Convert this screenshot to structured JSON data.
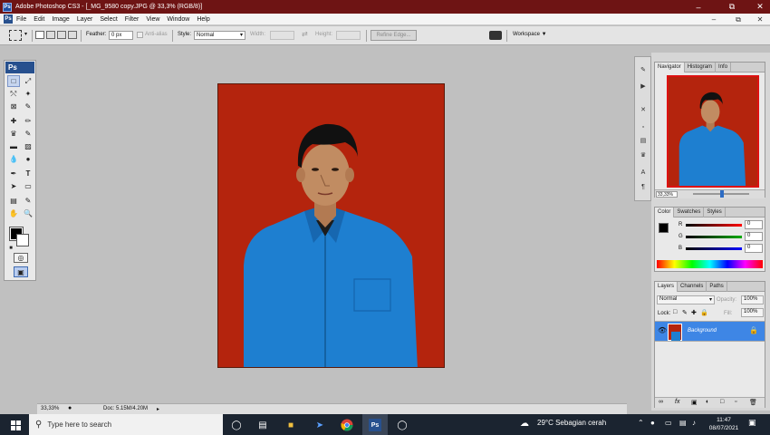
{
  "window": {
    "title": "Adobe Photoshop CS3 - [_MG_9580 copy.JPG @ 33,3% (RGB/8)]",
    "app_badge": "Ps",
    "controls": [
      "–",
      "⧉",
      "✕"
    ]
  },
  "menu": {
    "items": [
      "File",
      "Edit",
      "Image",
      "Layer",
      "Select",
      "Filter",
      "View",
      "Window",
      "Help"
    ]
  },
  "options": {
    "feather_label": "Feather:",
    "feather_value": "0 px",
    "antialias_label": "Anti-alias",
    "style_label": "Style:",
    "style_value": "Normal",
    "width_label": "Width:",
    "height_label": "Height:",
    "refine_edge": "Refine Edge...",
    "workspace": "Workspace ▼"
  },
  "toolbox": {
    "badge": "Ps"
  },
  "document": {
    "background_color": "#b4240d",
    "shirt_color": "#1e7fd0"
  },
  "navigator": {
    "tabs": [
      "Navigator",
      "Histogram",
      "Info"
    ],
    "zoom": "33,33%"
  },
  "color": {
    "tabs": [
      "Color",
      "Swatches",
      "Styles"
    ],
    "channels": [
      {
        "label": "R",
        "value": "0"
      },
      {
        "label": "G",
        "value": "0"
      },
      {
        "label": "B",
        "value": "0"
      }
    ]
  },
  "layers": {
    "tabs": [
      "Layers",
      "Channels",
      "Paths"
    ],
    "blend_mode": "Normal",
    "opacity_label": "Opacity:",
    "opacity_value": "100%",
    "lock_label": "Lock:",
    "fill_label": "Fill:",
    "fill_value": "100%",
    "layer_name": "Background"
  },
  "status": {
    "zoom": "33,33%",
    "doc": "Doc: 5.15M/4.20M"
  },
  "taskbar": {
    "search_placeholder": "Type here to search",
    "weather": "29°C  Sebagian cerah",
    "time": "11:47",
    "date": "08/07/2021"
  }
}
